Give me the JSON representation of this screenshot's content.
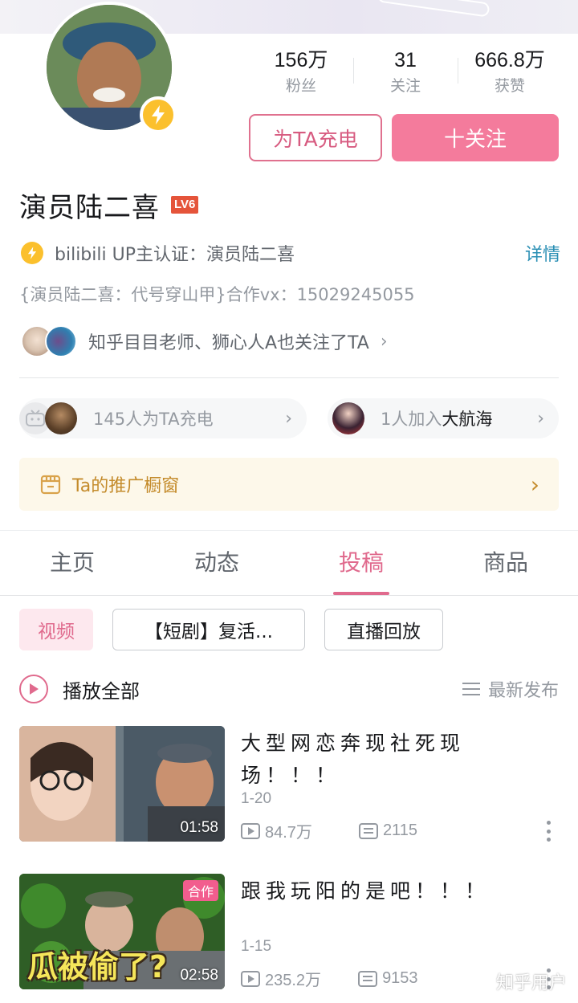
{
  "profile": {
    "name": "演员陆二喜",
    "level": "LV6",
    "stats": [
      {
        "value": "156万",
        "label": "粉丝"
      },
      {
        "value": "31",
        "label": "关注"
      },
      {
        "value": "666.8万",
        "label": "获赞"
      }
    ],
    "charge_button": "为TA充电",
    "follow_button": "十关注",
    "certification": "bilibili UP主认证：演员陆二喜",
    "cert_detail": "详情",
    "bio": "{演员陆二喜：代号穿山甲}合作vx：15029245055",
    "mutual_follow": "知乎目目老师、狮心人A也关注了TA",
    "charge_pill_count": "145人为TA充电",
    "fleet_pill_prefix": "1人加入",
    "fleet_pill_strong": "大航海",
    "showcase": "Ta的推广橱窗"
  },
  "tabs": [
    {
      "label": "主页",
      "active": false
    },
    {
      "label": "动态",
      "active": false
    },
    {
      "label": "投稿",
      "active": true
    },
    {
      "label": "商品",
      "active": false
    }
  ],
  "filters": [
    "视频",
    "【短剧】复活...",
    "直播回放"
  ],
  "list_header": {
    "play_all": "播放全部",
    "sort": "最新发布"
  },
  "videos": [
    {
      "title": "大型网恋奔现社死现场！！！",
      "date": "1-20",
      "duration": "01:58",
      "views": "84.7万",
      "danmaku": "2115"
    },
    {
      "title": "跟我玩阳的是吧！！！",
      "date": "1-15",
      "duration": "02:58",
      "views": "235.2万",
      "danmaku": "9153",
      "badge": "合作",
      "thumb_caption": "瓜被偷了?"
    }
  ],
  "watermark": "知乎用户",
  "colors": {
    "accent_pink": "#f47b9c",
    "link_blue": "#2a8fb4",
    "badge_yellow": "#fbc02d",
    "level_red": "#e5543a"
  }
}
